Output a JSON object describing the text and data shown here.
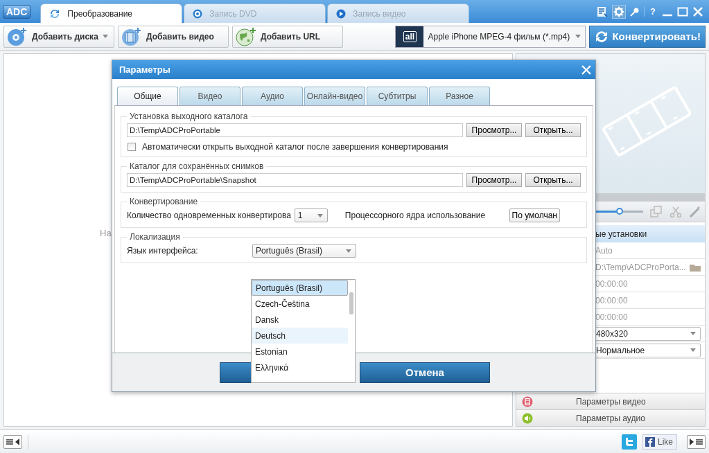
{
  "app": {
    "logo": "ADC"
  },
  "tabs": [
    {
      "label": "Преобразование",
      "selected": true
    },
    {
      "label": "Запись DVD",
      "selected": false
    },
    {
      "label": "Запись видео",
      "selected": false
    }
  ],
  "title_bar": {
    "help": "?"
  },
  "toolbar": {
    "buttons": [
      {
        "label": "Добавить диска",
        "dropdown": true
      },
      {
        "label": "Добавить видео",
        "dropdown": false
      },
      {
        "label": "Добавить URL",
        "dropdown": false
      }
    ],
    "format": {
      "badge": "all",
      "value": "Apple iPhone MPEG-4 фильм (*.mp4)"
    },
    "convert_button": "Конвертировать!"
  },
  "main": {
    "hint": "На"
  },
  "right_panel": {
    "slider": {
      "level": 0.5
    },
    "settings_header": "ые установки",
    "rows": [
      {
        "kind": "text",
        "value": "Auto"
      },
      {
        "kind": "path",
        "value": "D:\\Temp\\ADCProPorta..."
      },
      {
        "kind": "text",
        "value": "00:00:00"
      },
      {
        "kind": "text",
        "value": "00:00:00"
      },
      {
        "kind": "text",
        "value": "00:00:00"
      },
      {
        "kind": "select",
        "value": "480x320"
      },
      {
        "kind": "select",
        "value": "Нормальное"
      }
    ],
    "sections": [
      {
        "label": "Параметры видео"
      },
      {
        "label": "Параметры аудио"
      }
    ]
  },
  "status_bar": {
    "like": "Like"
  },
  "dialog": {
    "title": "Параметры",
    "tabs": [
      {
        "label": "Общие",
        "selected": true
      },
      {
        "label": "Видео",
        "selected": false
      },
      {
        "label": "Аудио",
        "selected": false
      },
      {
        "label": "Онлайн-видео",
        "selected": false
      },
      {
        "label": "Субтитры",
        "selected": false
      },
      {
        "label": "Разное",
        "selected": false
      }
    ],
    "folder_groups": [
      {
        "title": "Установка выходного каталога",
        "path": "D:\\Temp\\ADCProPortable",
        "browse": "Просмотр...",
        "open": "Открыть...",
        "checkbox": {
          "label": "Автоматически открыть выходной каталог после завершения конвертирования",
          "checked": false
        }
      },
      {
        "title": "Каталог для сохранённых снимков",
        "path": "D:\\Temp\\ADCProPortable\\Snapshot",
        "browse": "Просмотр...",
        "open": "Открыть..."
      }
    ],
    "conversion": {
      "title": "Конвертирование",
      "count_label": "Количество одновременных конвертирова",
      "count_value": "1",
      "cores_label": "Процессорного ядра использование",
      "cores_value": "По умолчан"
    },
    "localization": {
      "title": "Локализация",
      "language_label": "Язык интерфейса:",
      "language_value": "Português (Brasil)",
      "options": [
        {
          "label": "Português (Brasil)",
          "selected": true,
          "highlighted": false
        },
        {
          "label": "Czech-Čeština",
          "selected": false,
          "highlighted": false
        },
        {
          "label": "Dansk",
          "selected": false,
          "highlighted": false
        },
        {
          "label": "Deutsch",
          "selected": false,
          "highlighted": true
        },
        {
          "label": "Estonian",
          "selected": false,
          "highlighted": false
        },
        {
          "label": "Ελληνικά",
          "selected": false,
          "highlighted": false
        }
      ]
    },
    "cancel_button": "Отмена"
  }
}
